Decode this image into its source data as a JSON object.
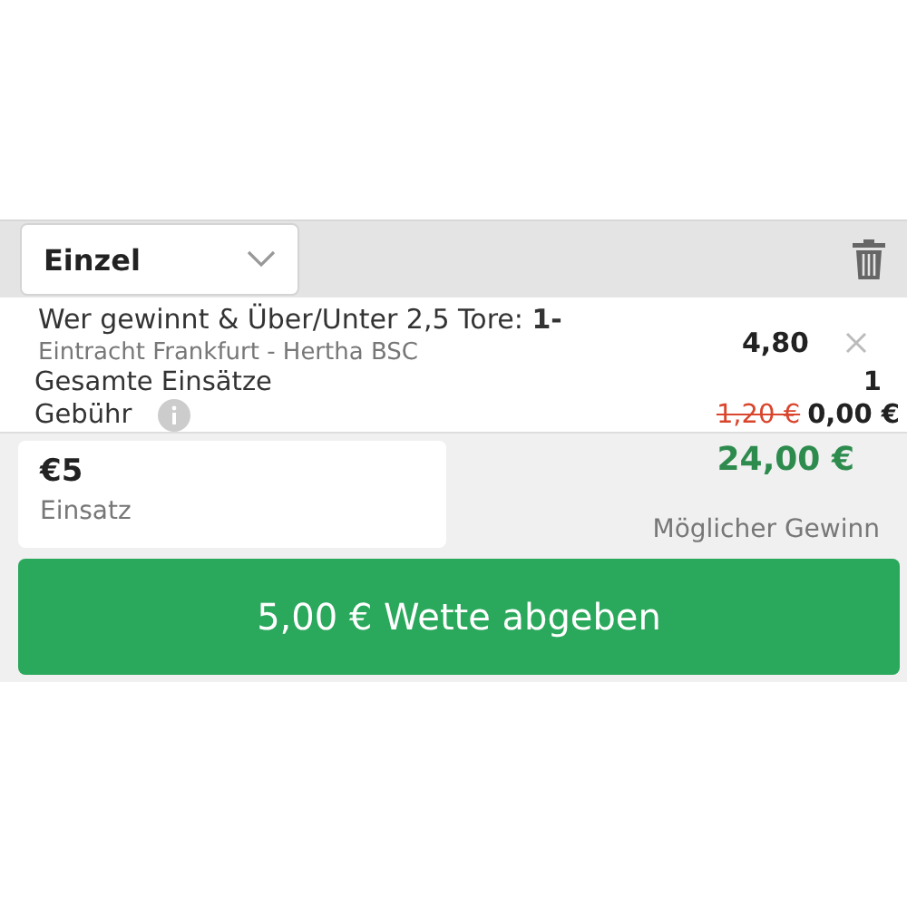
{
  "bet_type": {
    "value": "Einzel"
  },
  "selection": {
    "market": "Wer gewinnt & Über/Unter 2,5 Tore: **1-**",
    "event": "Eintracht Frankfurt - Hertha BSC",
    "odds": "4,80"
  },
  "summary": {
    "total_stakes_label": "Gesamte Einsätze",
    "total_stakes": "1",
    "fee_label": "Gebühr",
    "fee_old": "1,20 €",
    "fee": "0,00 €"
  },
  "stake": {
    "value": "€5",
    "label": "Einsatz"
  },
  "potential_win": {
    "amount": "24,00 €",
    "label": "Möglicher Gewinn"
  },
  "submit_button": "5,00 € Wette abgeben"
}
